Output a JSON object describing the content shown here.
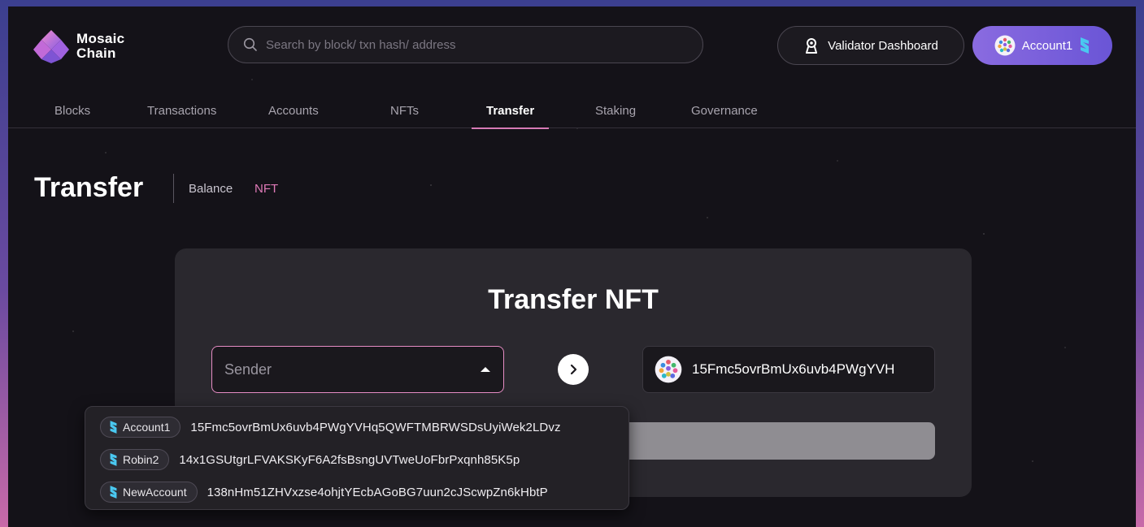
{
  "brand": {
    "line1": "Mosaic",
    "line2": "Chain"
  },
  "search": {
    "placeholder": "Search by block/ txn hash/ address"
  },
  "header": {
    "validator_label": "Validator Dashboard",
    "account_label": "Account1"
  },
  "nav": {
    "items": [
      {
        "label": "Blocks"
      },
      {
        "label": "Transactions"
      },
      {
        "label": "Accounts"
      },
      {
        "label": "NFTs"
      },
      {
        "label": "Transfer"
      },
      {
        "label": "Staking"
      },
      {
        "label": "Governance"
      }
    ],
    "active": "Transfer"
  },
  "page": {
    "title": "Transfer",
    "subtabs": {
      "balance": "Balance",
      "nft": "NFT"
    },
    "active_subtab": "NFT"
  },
  "card": {
    "title": "Transfer NFT",
    "sender_placeholder": "Sender",
    "receiver_address": "15Fmc5ovrBmUx6uvb4PWgYVH"
  },
  "dropdown": {
    "accounts": [
      {
        "name": "Account1",
        "address": "15Fmc5ovrBmUx6uvb4PWgYVHq5QWFTMBRWSDsUyiWek2LDvz"
      },
      {
        "name": "Robin2",
        "address": "14x1GSUtgrLFVAKSKyF6A2fsBsngUVTweUoFbrPxqnh85K5p"
      },
      {
        "name": "NewAccount",
        "address": "138nHm51ZHVxzse4ohjtYEcbAGoBG7uun2cJScwpZn6kHbtP"
      }
    ]
  },
  "colors": {
    "accent_pink": "#e07ab8",
    "account_button": "#7a60de",
    "card_bg": "#2a282e",
    "page_bg": "#141218"
  },
  "icons": {
    "search": "search-icon",
    "validator": "validator-icon",
    "avatar": "mosaic-avatar-icon",
    "chain": "chain-s-icon",
    "arrow": "chevron-right-icon",
    "caret": "caret-up-icon"
  }
}
